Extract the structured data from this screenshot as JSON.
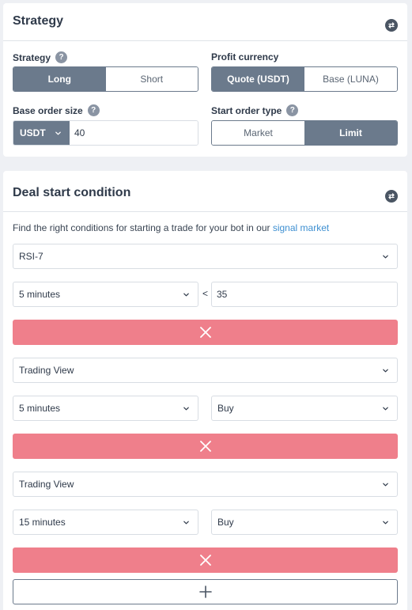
{
  "strategy_card": {
    "title": "Strategy",
    "strategy": {
      "label": "Strategy",
      "options": [
        "Long",
        "Short"
      ],
      "selected": "Long"
    },
    "profit_currency": {
      "label": "Profit currency",
      "options": [
        "Quote (USDT)",
        "Base (LUNA)"
      ],
      "selected": "Quote (USDT)"
    },
    "base_order_size": {
      "label": "Base order size",
      "currency": "USDT",
      "value": "40"
    },
    "start_order_type": {
      "label": "Start order type",
      "options": [
        "Market",
        "Limit"
      ],
      "selected": "Limit"
    },
    "help_glyph": "?"
  },
  "deal_card": {
    "title": "Deal start condition",
    "intro_text": "Find the right conditions for starting a trade for your bot in our ",
    "intro_link": "signal market",
    "conditions": [
      {
        "source": "RSI-7",
        "timeframe": "5 minutes",
        "operator": "<",
        "value": "35"
      },
      {
        "source": "Trading View",
        "timeframe": "5 minutes",
        "signal": "Buy"
      },
      {
        "source": "Trading View",
        "timeframe": "15 minutes",
        "signal": "Buy"
      }
    ]
  },
  "colors": {
    "accent": "#6b7a8c",
    "danger": "#ef7f8b",
    "link": "#3d8fd1"
  },
  "icons": {
    "header": "swap-arrows-icon",
    "help": "question-circle-icon",
    "dropdown": "chevron-down-icon",
    "remove": "close-icon",
    "add": "plus-icon"
  }
}
